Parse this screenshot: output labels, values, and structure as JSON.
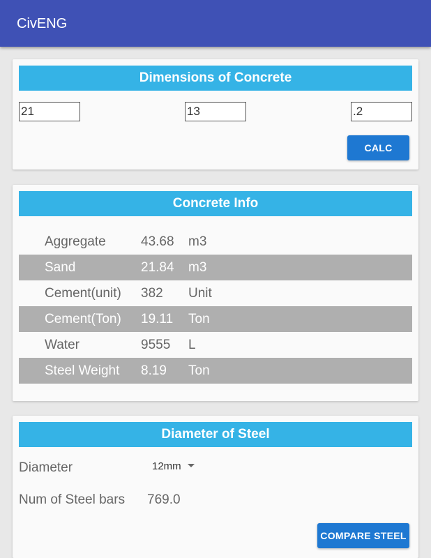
{
  "app": {
    "title": "CivENG"
  },
  "dimensions": {
    "header": "Dimensions of Concrete",
    "inputs": [
      "21",
      "13",
      ".2"
    ],
    "calc_label": "CALC"
  },
  "concrete_info": {
    "header": "Concrete Info",
    "rows": [
      {
        "name": "Aggregate",
        "value": "43.68",
        "unit": "m3"
      },
      {
        "name": "Sand",
        "value": "21.84",
        "unit": "m3"
      },
      {
        "name": "Cement(unit)",
        "value": "382",
        "unit": "Unit"
      },
      {
        "name": "Cement(Ton)",
        "value": "19.11",
        "unit": "Ton"
      },
      {
        "name": "Water",
        "value": "9555",
        "unit": "L"
      },
      {
        "name": "Steel Weight",
        "value": "8.19",
        "unit": "Ton"
      }
    ]
  },
  "steel": {
    "header": "Diameter of Steel",
    "diameter_label": "Diameter",
    "diameter_selected": "12mm",
    "num_bars_label": "Num of Steel bars",
    "num_bars_value": "769.0",
    "compare_label": "COMPARE STEEL"
  },
  "colors": {
    "appbar": "#3f51b5",
    "header": "#35b3e6",
    "button": "#1e78d2",
    "row_shade": "#afafaf"
  }
}
